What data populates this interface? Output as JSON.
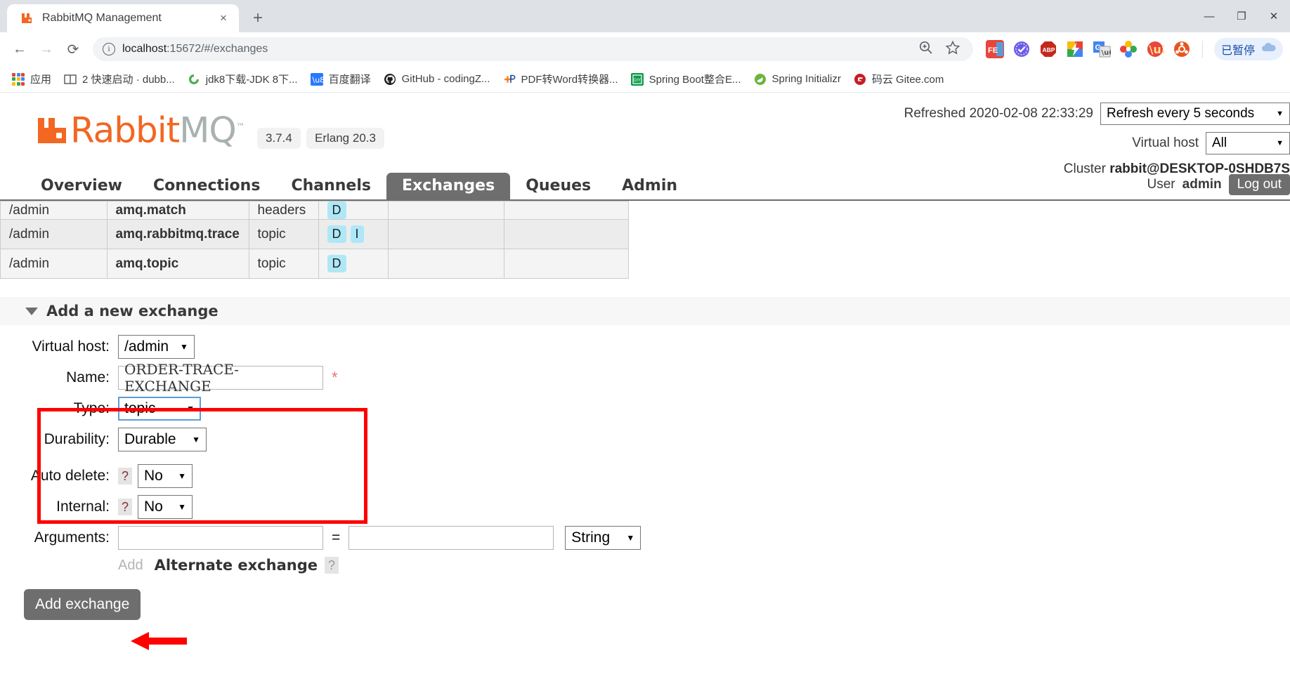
{
  "browser": {
    "tab": {
      "title": "RabbitMQ Management",
      "favicon": "rabbitmq-icon",
      "close": "×"
    },
    "new_tab": "+",
    "window_controls": {
      "minimize": "—",
      "maximize": "❐",
      "close": "✕"
    },
    "nav": {
      "back": "←",
      "forward": "→",
      "reload": "⟳"
    },
    "omnibox": {
      "info_icon": "i",
      "url_host": "localhost",
      "url_path": ":15672/#/exchanges",
      "zoom_icon": "zoom-in-icon",
      "star_icon": "☆"
    },
    "extensions": [
      {
        "name": "fe-extension",
        "label": "FE",
        "color": "#e8453c"
      },
      {
        "name": "checkmark-extension",
        "label": "✓",
        "color": "#6b5ce7"
      },
      {
        "name": "adblock-plus-extension",
        "label": "ABP",
        "color": "#c4281c"
      },
      {
        "name": "lightning-extension",
        "label": "⚡",
        "color": "#34a853"
      },
      {
        "name": "google-translate-extension",
        "label": "G",
        "color": "#4285f4"
      },
      {
        "name": "photos-extension",
        "label": "✿",
        "color": "#e8453c"
      },
      {
        "name": "infinity-extension",
        "label": "∞",
        "color": "#e8453c"
      },
      {
        "name": "ubuntu-extension",
        "label": "⬤",
        "color": "#e95420"
      }
    ],
    "paused_pill": {
      "label": "已暂停",
      "icon": "cloud-icon"
    },
    "bookmarks": [
      {
        "label": "应用",
        "icon": "apps-grid-icon"
      },
      {
        "label": "2 快速启动 · dubb...",
        "icon": "book-icon"
      },
      {
        "label": "jdk8下载-JDK 8下...",
        "icon": "oracle-icon"
      },
      {
        "label": "百度翻译",
        "icon": "translate-icon"
      },
      {
        "label": "GitHub - codingZ...",
        "icon": "github-icon"
      },
      {
        "label": "PDF转Word转换器...",
        "icon": "pdf-icon"
      },
      {
        "label": "Spring Boot整合E...",
        "icon": "diy-icon"
      },
      {
        "label": "Spring Initializr",
        "icon": "spring-icon"
      },
      {
        "label": "码云 Gitee.com",
        "icon": "gitee-icon"
      }
    ]
  },
  "app": {
    "logo": {
      "rabbit": "Rabbit",
      "mq": "MQ",
      "tm": "™"
    },
    "version_badge": "3.7.4",
    "erlang_badge": "Erlang 20.3",
    "refreshed_label": "Refreshed 2020-02-08 22:33:29",
    "refresh_select": {
      "value": "Refresh every 5 seconds",
      "caret": "▼"
    },
    "vhost_label": "Virtual host",
    "vhost_select": {
      "value": "All",
      "caret": "▼"
    },
    "cluster_label": "Cluster",
    "cluster_name": "rabbit@DESKTOP-0SHDB7S",
    "user_label": "User",
    "user_name": "admin",
    "logout_label": "Log out",
    "nav_tabs": [
      {
        "label": "Overview",
        "active": false
      },
      {
        "label": "Connections",
        "active": false
      },
      {
        "label": "Channels",
        "active": false
      },
      {
        "label": "Exchanges",
        "active": true
      },
      {
        "label": "Queues",
        "active": false
      },
      {
        "label": "Admin",
        "active": false
      }
    ]
  },
  "exchanges_table": {
    "rows": [
      {
        "vhost": "/admin",
        "name": "amq.match",
        "type": "headers",
        "features": [
          "D"
        ]
      },
      {
        "vhost": "/admin",
        "name": "amq.rabbitmq.trace",
        "type": "topic",
        "features": [
          "D",
          "I"
        ]
      },
      {
        "vhost": "/admin",
        "name": "amq.topic",
        "type": "topic",
        "features": [
          "D"
        ]
      }
    ]
  },
  "add_exchange": {
    "section_title": "Add a new exchange",
    "fields": {
      "vhost": {
        "label": "Virtual host:",
        "value": "/admin",
        "caret": "▼"
      },
      "name": {
        "label": "Name:",
        "value": "ORDER-TRACE-EXCHANGE",
        "required_mark": "*"
      },
      "type": {
        "label": "Type:",
        "value": "topic",
        "caret": "▼"
      },
      "durability": {
        "label": "Durability:",
        "value": "Durable",
        "caret": "▼"
      },
      "auto_delete": {
        "label": "Auto delete:",
        "value": "No",
        "help": "?",
        "caret": "▼"
      },
      "internal": {
        "label": "Internal:",
        "value": "No",
        "help": "?",
        "caret": "▼"
      },
      "arguments": {
        "label": "Arguments:",
        "key_value": "",
        "value_value": "",
        "equals": "=",
        "type": "String",
        "caret": "▼"
      },
      "add_link": "Add",
      "alternate_exchange": "Alternate exchange",
      "alternate_help": "?"
    },
    "submit_label": "Add exchange"
  },
  "annotations": {
    "highlight_box_color": "#ff0000",
    "arrow_color": "#ff0000"
  }
}
